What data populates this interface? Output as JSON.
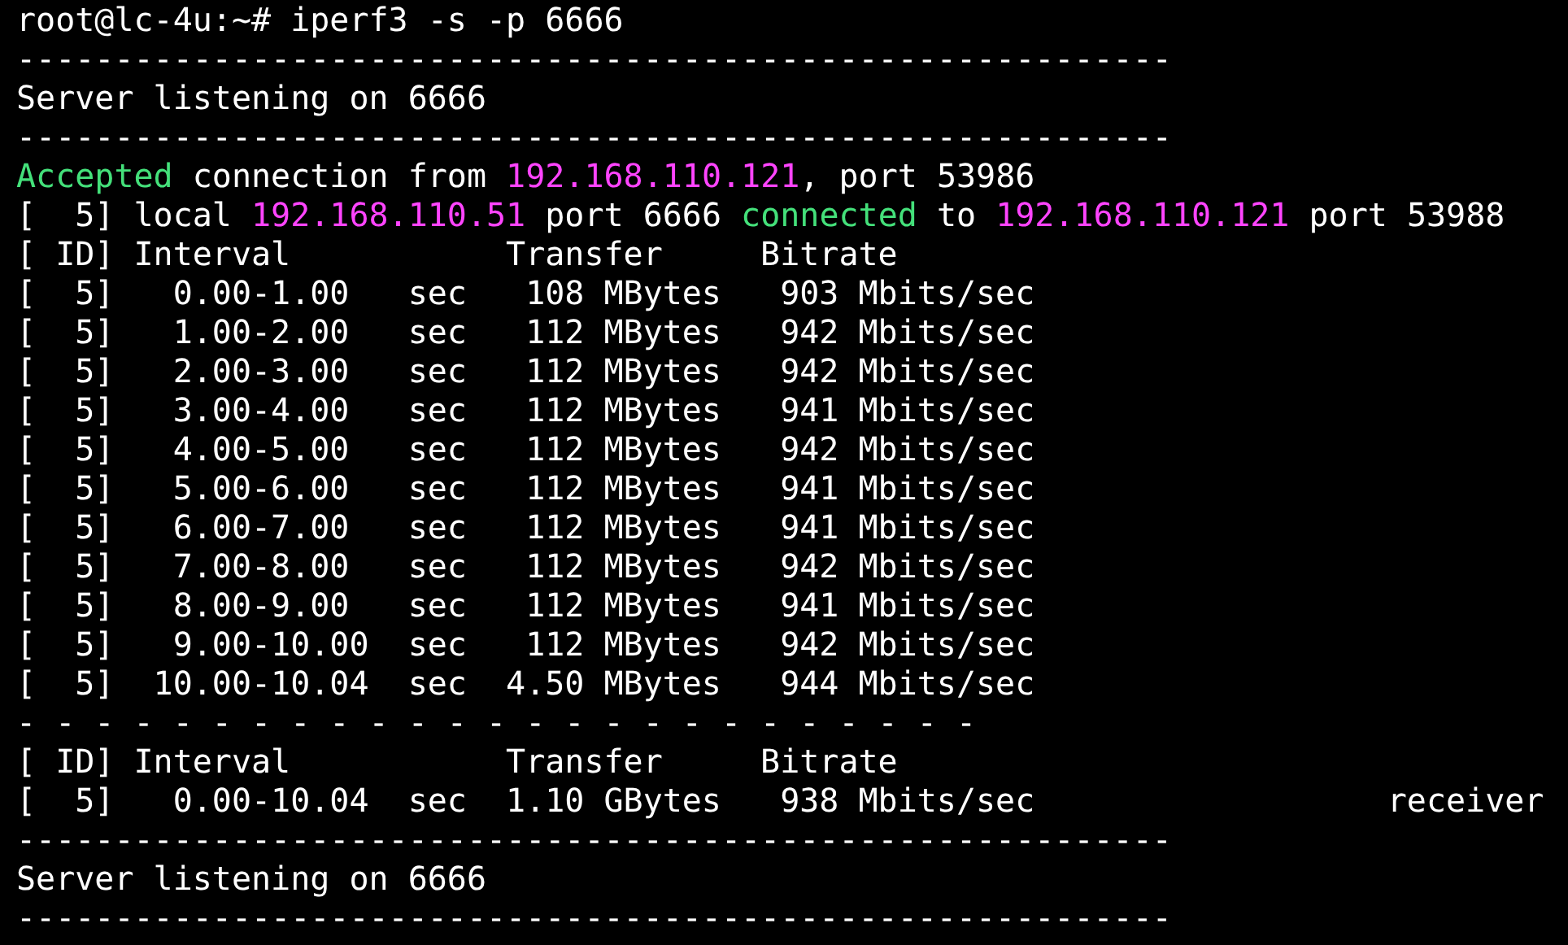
{
  "terminal": {
    "lines": [
      {
        "segments": [
          {
            "text": "root@lc-4u:~# iperf3 -s -p 6666",
            "color": "#ffffff"
          }
        ]
      },
      {
        "segments": [
          {
            "text": "-----------------------------------------------------------",
            "color": "#ffffff"
          }
        ]
      },
      {
        "segments": [
          {
            "text": "Server listening on 6666",
            "color": "#ffffff"
          }
        ]
      },
      {
        "segments": [
          {
            "text": "-----------------------------------------------------------",
            "color": "#ffffff"
          }
        ]
      },
      {
        "segments": [
          {
            "text": "Accepted",
            "color": "#44e07a"
          },
          {
            "text": " connection from ",
            "color": "#ffffff"
          },
          {
            "text": "192.168.110.121",
            "color": "#ff44ff"
          },
          {
            "text": ", port 53986",
            "color": "#ffffff"
          }
        ]
      },
      {
        "segments": [
          {
            "text": "[  5] local ",
            "color": "#ffffff"
          },
          {
            "text": "192.168.110.51",
            "color": "#ff44ff"
          },
          {
            "text": " port 6666 ",
            "color": "#ffffff"
          },
          {
            "text": "connected",
            "color": "#44e07a"
          },
          {
            "text": " to ",
            "color": "#ffffff"
          },
          {
            "text": "192.168.110.121",
            "color": "#ff44ff"
          },
          {
            "text": " port 53988",
            "color": "#ffffff"
          }
        ]
      },
      {
        "segments": [
          {
            "text": "[ ID] Interval           Transfer     Bitrate",
            "color": "#ffffff"
          }
        ]
      },
      {
        "segments": [
          {
            "text": "[  5]   0.00-1.00   sec   108 MBytes   903 Mbits/sec",
            "color": "#ffffff"
          }
        ]
      },
      {
        "segments": [
          {
            "text": "[  5]   1.00-2.00   sec   112 MBytes   942 Mbits/sec",
            "color": "#ffffff"
          }
        ]
      },
      {
        "segments": [
          {
            "text": "[  5]   2.00-3.00   sec   112 MBytes   942 Mbits/sec",
            "color": "#ffffff"
          }
        ]
      },
      {
        "segments": [
          {
            "text": "[  5]   3.00-4.00   sec   112 MBytes   941 Mbits/sec",
            "color": "#ffffff"
          }
        ]
      },
      {
        "segments": [
          {
            "text": "[  5]   4.00-5.00   sec   112 MBytes   942 Mbits/sec",
            "color": "#ffffff"
          }
        ]
      },
      {
        "segments": [
          {
            "text": "[  5]   5.00-6.00   sec   112 MBytes   941 Mbits/sec",
            "color": "#ffffff"
          }
        ]
      },
      {
        "segments": [
          {
            "text": "[  5]   6.00-7.00   sec   112 MBytes   941 Mbits/sec",
            "color": "#ffffff"
          }
        ]
      },
      {
        "segments": [
          {
            "text": "[  5]   7.00-8.00   sec   112 MBytes   942 Mbits/sec",
            "color": "#ffffff"
          }
        ]
      },
      {
        "segments": [
          {
            "text": "[  5]   8.00-9.00   sec   112 MBytes   941 Mbits/sec",
            "color": "#ffffff"
          }
        ]
      },
      {
        "segments": [
          {
            "text": "[  5]   9.00-10.00  sec   112 MBytes   942 Mbits/sec",
            "color": "#ffffff"
          }
        ]
      },
      {
        "segments": [
          {
            "text": "[  5]  10.00-10.04  sec  4.50 MBytes   944 Mbits/sec",
            "color": "#ffffff"
          }
        ]
      },
      {
        "segments": [
          {
            "text": "- - - - - - - - - - - - - - - - - - - - - - - - -",
            "color": "#ffffff"
          }
        ]
      },
      {
        "segments": [
          {
            "text": "[ ID] Interval           Transfer     Bitrate",
            "color": "#ffffff"
          }
        ]
      },
      {
        "segments": [
          {
            "text": "[  5]   0.00-10.04  sec  1.10 GBytes   938 Mbits/sec                  receiver",
            "color": "#ffffff"
          }
        ]
      },
      {
        "segments": [
          {
            "text": "-----------------------------------------------------------",
            "color": "#ffffff"
          }
        ]
      },
      {
        "segments": [
          {
            "text": "Server listening on 6666",
            "color": "#ffffff"
          }
        ]
      },
      {
        "segments": [
          {
            "text": "-----------------------------------------------------------",
            "color": "#ffffff"
          }
        ]
      }
    ]
  }
}
